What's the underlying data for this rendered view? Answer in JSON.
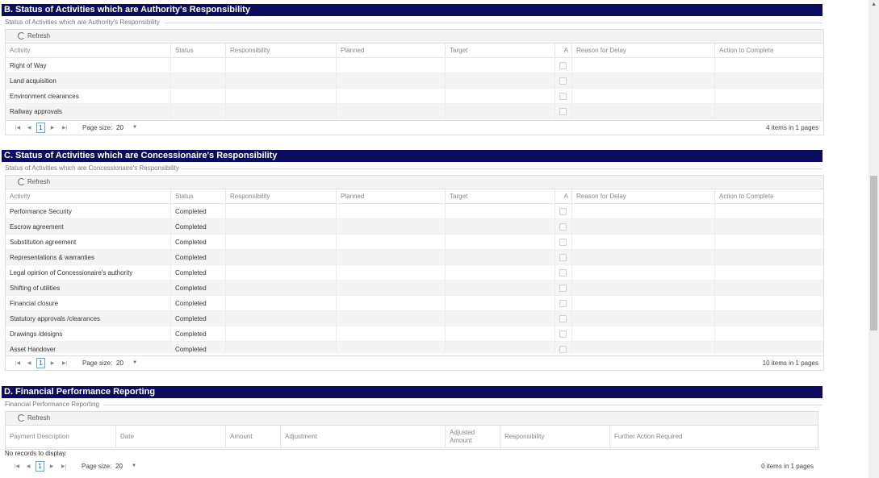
{
  "sectionB": {
    "title": "B. Status of Activities which are Authority's Responsibility",
    "subtitle": "Status of Activities which are Authority's Responsibility",
    "refresh": "Refresh",
    "headers": [
      "Activity",
      "Status",
      "Responsibility",
      "Planned",
      "Target",
      "A",
      "Reason for Delay",
      "Action to Complete"
    ],
    "rows": [
      {
        "activity": "Right of Way",
        "status": ""
      },
      {
        "activity": "Land acquisition",
        "status": ""
      },
      {
        "activity": "Environment clearances",
        "status": ""
      },
      {
        "activity": "Railway approvals",
        "status": ""
      }
    ],
    "pager": {
      "page": "1",
      "page_size_label": "Page size:",
      "page_size": "20",
      "info": "4 items in 1 pages"
    }
  },
  "sectionC": {
    "title": "C. Status of Activities which are Concessionaire's Responsibility",
    "subtitle": "Status of Activities which are Concessionaire's Responsibility",
    "refresh": "Refresh",
    "headers": [
      "Activity",
      "Status",
      "Responsibility",
      "Planned",
      "Target",
      "A",
      "Reason for Delay",
      "Action to Complete"
    ],
    "rows": [
      {
        "activity": "Performance Security",
        "status": "Completed"
      },
      {
        "activity": "Escrow agreement",
        "status": "Completed"
      },
      {
        "activity": "Substitution agreement",
        "status": "Completed"
      },
      {
        "activity": "Representations & warranties",
        "status": "Completed"
      },
      {
        "activity": "Legal opinion of Concessionaire's authority",
        "status": "Completed"
      },
      {
        "activity": "Shifting of utilities",
        "status": "Completed"
      },
      {
        "activity": "Financial closure",
        "status": "Completed"
      },
      {
        "activity": "Statutory approvals /clearances",
        "status": "Completed"
      },
      {
        "activity": "Drawings /designs",
        "status": "Completed"
      },
      {
        "activity": "Asset Handover",
        "status": "Completed"
      }
    ],
    "pager": {
      "page": "1",
      "page_size_label": "Page size:",
      "page_size": "20",
      "info": "10 items in 1 pages"
    }
  },
  "sectionD": {
    "title": "D. Financial Performance Reporting",
    "subtitle": "Financial Performance Reporting",
    "refresh": "Refresh",
    "headers": [
      "Payment Description",
      "Date",
      "Amount",
      "Adjustment",
      "Adjusted Amount",
      "Responsibility",
      "Further Action Required"
    ],
    "empty": "No records to display.",
    "pager": {
      "page": "1",
      "page_size_label": "Page size:",
      "page_size": "20",
      "info": "0 items in 1 pages"
    }
  }
}
